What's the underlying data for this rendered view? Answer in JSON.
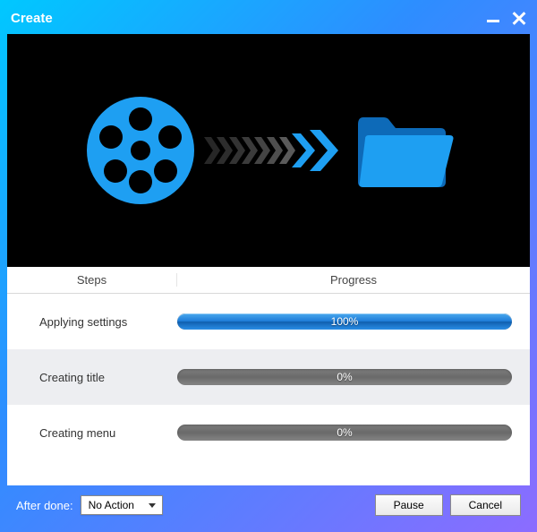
{
  "window": {
    "title": "Create"
  },
  "columns": {
    "steps": "Steps",
    "progress": "Progress"
  },
  "rows": [
    {
      "label": "Applying settings",
      "percent": 100,
      "percent_text": "100%"
    },
    {
      "label": "Creating title",
      "percent": 0,
      "percent_text": "0%"
    },
    {
      "label": "Creating menu",
      "percent": 0,
      "percent_text": "0%"
    }
  ],
  "footer": {
    "after_done_label": "After done:",
    "after_done_value": "No Action",
    "pause": "Pause",
    "cancel": "Cancel"
  },
  "colors": {
    "accent": "#1e90ff"
  }
}
